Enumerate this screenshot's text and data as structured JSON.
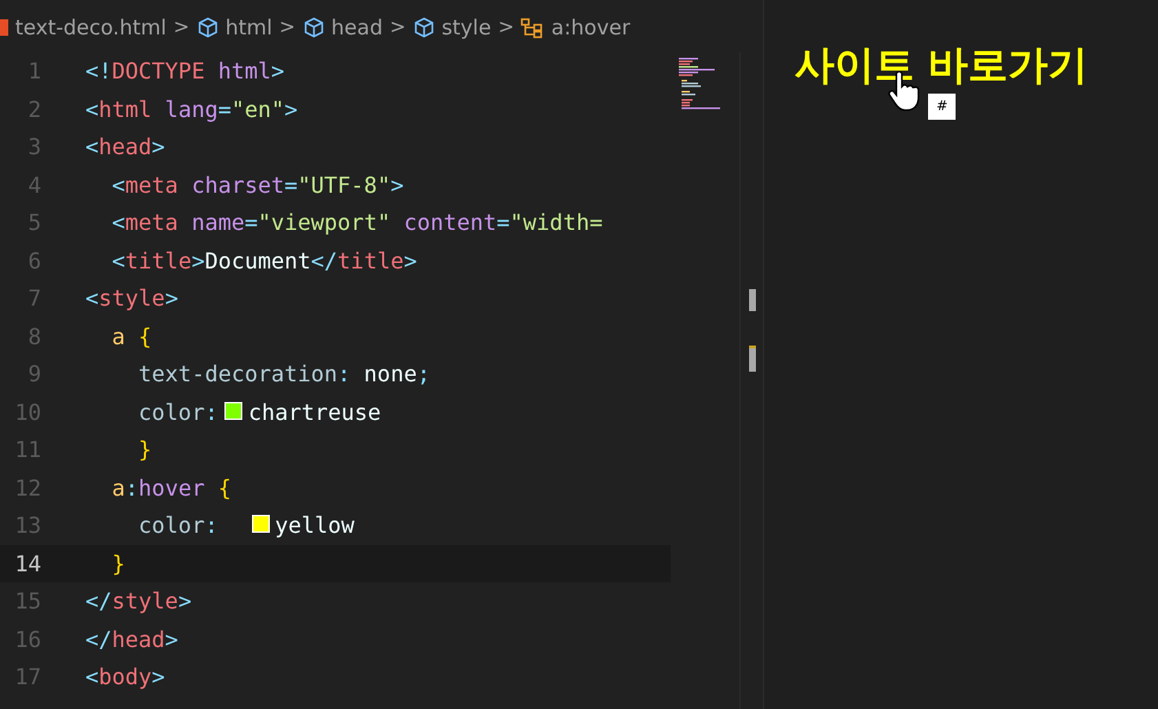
{
  "breadcrumbs": [
    {
      "kind": "file",
      "label": "text-deco.html"
    },
    {
      "kind": "element",
      "label": "html",
      "separator": ">"
    },
    {
      "kind": "element",
      "label": "head",
      "separator": ">"
    },
    {
      "kind": "element",
      "label": "style",
      "separator": ">"
    },
    {
      "kind": "selector",
      "label": "a:hover",
      "separator": ">"
    }
  ],
  "editor": {
    "lines": [
      {
        "number": "1",
        "current": false,
        "tokens": [
          {
            "kind": "punct",
            "text": "<!"
          },
          {
            "kind": "tag",
            "text": "DOCTYPE"
          },
          {
            "kind": "attr",
            "text": " html"
          },
          {
            "kind": "punct",
            "text": ">"
          }
        ]
      },
      {
        "number": "2",
        "current": false,
        "tokens": [
          {
            "kind": "punct",
            "text": "<"
          },
          {
            "kind": "tag",
            "text": "html"
          },
          {
            "kind": "attr",
            "text": " lang"
          },
          {
            "kind": "punct",
            "text": "="
          },
          {
            "kind": "string",
            "text": "\"en\""
          },
          {
            "kind": "punct",
            "text": ">"
          }
        ]
      },
      {
        "number": "3",
        "current": false,
        "tokens": [
          {
            "kind": "punct",
            "text": "<"
          },
          {
            "kind": "tag",
            "text": "head"
          },
          {
            "kind": "punct",
            "text": ">"
          }
        ]
      },
      {
        "number": "4",
        "current": false,
        "tokens": [
          {
            "kind": "punct",
            "text": "  <"
          },
          {
            "kind": "tag",
            "text": "meta"
          },
          {
            "kind": "attr",
            "text": " charset"
          },
          {
            "kind": "punct",
            "text": "="
          },
          {
            "kind": "string",
            "text": "\"UTF-8\""
          },
          {
            "kind": "punct",
            "text": ">"
          }
        ]
      },
      {
        "number": "5",
        "current": false,
        "tokens": [
          {
            "kind": "punct",
            "text": "  <"
          },
          {
            "kind": "tag",
            "text": "meta"
          },
          {
            "kind": "attr",
            "text": " name"
          },
          {
            "kind": "punct",
            "text": "="
          },
          {
            "kind": "string",
            "text": "\"viewport\""
          },
          {
            "kind": "attr",
            "text": " content"
          },
          {
            "kind": "punct",
            "text": "="
          },
          {
            "kind": "string",
            "text": "\"width="
          }
        ]
      },
      {
        "number": "6",
        "current": false,
        "tokens": [
          {
            "kind": "punct",
            "text": "  <"
          },
          {
            "kind": "tag",
            "text": "title"
          },
          {
            "kind": "punct",
            "text": ">"
          },
          {
            "kind": "plain",
            "text": "Document"
          },
          {
            "kind": "punct",
            "text": "</"
          },
          {
            "kind": "tag",
            "text": "title"
          },
          {
            "kind": "punct",
            "text": ">"
          }
        ]
      },
      {
        "number": "7",
        "current": false,
        "tokens": [
          {
            "kind": "punct",
            "text": "<"
          },
          {
            "kind": "tag",
            "text": "style"
          },
          {
            "kind": "punct",
            "text": ">"
          }
        ]
      },
      {
        "number": "8",
        "current": false,
        "tokens": [
          {
            "kind": "selector",
            "text": "  a"
          },
          {
            "kind": "brace",
            "text": " {"
          }
        ]
      },
      {
        "number": "9",
        "current": false,
        "tokens": [
          {
            "kind": "property",
            "text": "    text-decoration"
          },
          {
            "kind": "punct",
            "text": ": "
          },
          {
            "kind": "plain",
            "text": "none"
          },
          {
            "kind": "punct",
            "text": ";"
          }
        ]
      },
      {
        "number": "10",
        "current": false,
        "tokens": [
          {
            "kind": "property",
            "text": "    color"
          },
          {
            "kind": "punct",
            "text": ":"
          },
          {
            "kind": "swatch",
            "color": "#7fff00"
          },
          {
            "kind": "plain",
            "text": "chartreuse"
          }
        ]
      },
      {
        "number": "11",
        "current": false,
        "tokens": [
          {
            "kind": "brace",
            "text": "    }"
          }
        ]
      },
      {
        "number": "12",
        "current": false,
        "tokens": [
          {
            "kind": "selector",
            "text": "  a"
          },
          {
            "kind": "punct",
            "text": ":"
          },
          {
            "kind": "pseudo",
            "text": "hover"
          },
          {
            "kind": "brace",
            "text": " {"
          }
        ]
      },
      {
        "number": "13",
        "current": false,
        "tokens": [
          {
            "kind": "property",
            "text": "    color"
          },
          {
            "kind": "punct",
            "text": ":  "
          },
          {
            "kind": "swatch",
            "color": "#ffff00"
          },
          {
            "kind": "plain",
            "text": "yellow"
          }
        ]
      },
      {
        "number": "14",
        "current": true,
        "tokens": [
          {
            "kind": "brace",
            "text": "  }"
          }
        ]
      },
      {
        "number": "15",
        "current": false,
        "tokens": [
          {
            "kind": "punct",
            "text": "</"
          },
          {
            "kind": "tag",
            "text": "style"
          },
          {
            "kind": "punct",
            "text": ">"
          }
        ]
      },
      {
        "number": "16",
        "current": false,
        "tokens": [
          {
            "kind": "punct",
            "text": "</"
          },
          {
            "kind": "tag",
            "text": "head"
          },
          {
            "kind": "punct",
            "text": ">"
          }
        ]
      },
      {
        "number": "17",
        "current": false,
        "tokens": [
          {
            "kind": "punct",
            "text": "<"
          },
          {
            "kind": "tag",
            "text": "body"
          },
          {
            "kind": "punct",
            "text": ">"
          }
        ]
      }
    ]
  },
  "preview": {
    "link": "사이트 바로가기",
    "tooltip": "#"
  }
}
